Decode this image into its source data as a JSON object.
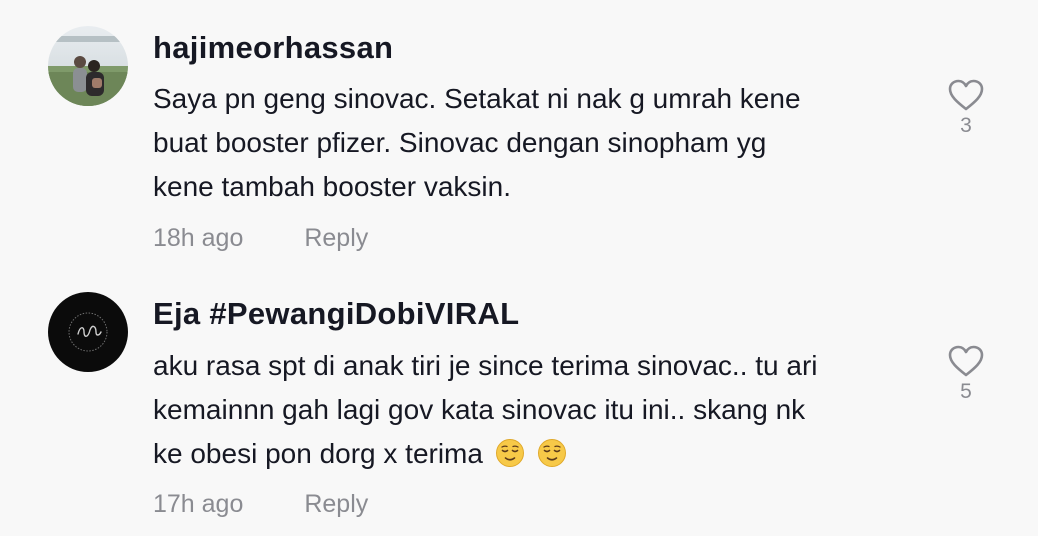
{
  "comments": [
    {
      "username": "hajimeorhassan",
      "text_lines": [
        "Saya pn geng sinovac. Setakat ni nak g umrah kene",
        "buat booster pfizer. Sinovac dengan sinopham yg",
        "kene tambah booster vaksin."
      ],
      "time": "18h ago",
      "reply_label": "Reply",
      "likes": "3",
      "avatar_icon": "photo-avatar"
    },
    {
      "username": "Eja #PewangiDobiVIRAL",
      "text_lines": [
        "aku rasa spt di anak tiri je since terima sinovac.. tu ari",
        "kemainnn gah lagi gov kata sinovac itu ini.. skang nk",
        "ke obesi pon dorg x terima"
      ],
      "emojis": [
        "relieved-face",
        "relieved-face"
      ],
      "time": "17h ago",
      "reply_label": "Reply",
      "likes": "5",
      "avatar_icon": "logo-avatar"
    }
  ],
  "colors": {
    "background": "#f8f8f8",
    "text": "#161823",
    "muted": "#8a8b91"
  }
}
